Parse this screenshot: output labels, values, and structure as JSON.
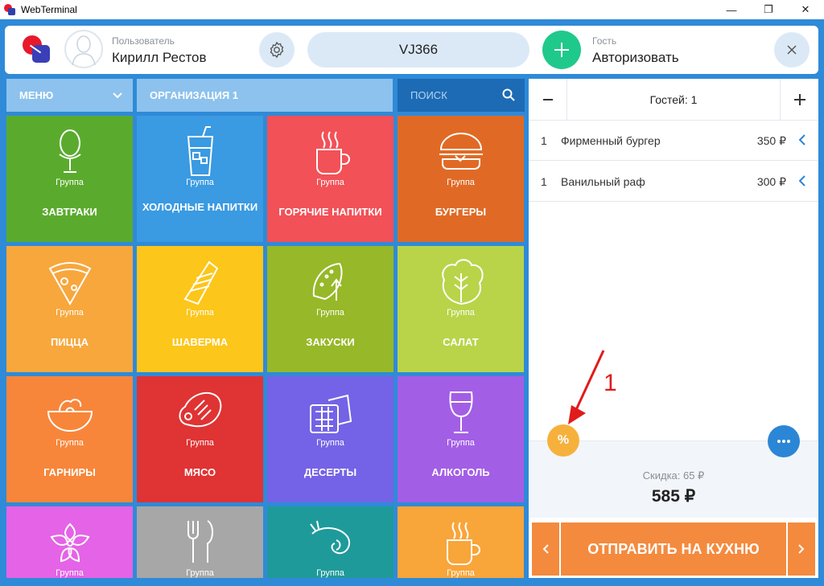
{
  "window": {
    "title": "WebTerminal",
    "minimize": "—",
    "maximize": "❐",
    "close": "✕"
  },
  "header": {
    "user_caption": "Пользователь",
    "user_name": "Кирилл Рестов",
    "order_code": "VJ366",
    "guest_caption": "Гость",
    "guest_action": "Авторизовать"
  },
  "toolbar": {
    "menu_label": "МЕНЮ",
    "org_label": "ОРГАНИЗАЦИЯ 1",
    "search_label": "ПОИСК"
  },
  "tiles": [
    {
      "group": "Группа",
      "name": "ЗАВТРАКИ",
      "color": "#5aab2d",
      "icon": "egg-icon"
    },
    {
      "group": "Группа",
      "name": "ХОЛОДНЫЕ НАПИТКИ",
      "color": "#3a9ae2",
      "icon": "cold-drink-icon"
    },
    {
      "group": "Группа",
      "name": "ГОРЯЧИЕ НАПИТКИ",
      "color": "#f25157",
      "icon": "hot-drink-icon"
    },
    {
      "group": "Группа",
      "name": "БУРГЕРЫ",
      "color": "#e06a25",
      "icon": "burger-icon"
    },
    {
      "group": "Группа",
      "name": "ПИЦЦА",
      "color": "#f7a73c",
      "icon": "pizza-icon"
    },
    {
      "group": "Группа",
      "name": "ШАВЕРМА",
      "color": "#fcc61a",
      "icon": "shawarma-icon"
    },
    {
      "group": "Группа",
      "name": "ЗАКУСКИ",
      "color": "#97b828",
      "icon": "snacks-icon"
    },
    {
      "group": "Группа",
      "name": "САЛАТ",
      "color": "#b9d449",
      "icon": "salad-icon"
    },
    {
      "group": "Группа",
      "name": "ГАРНИРЫ",
      "color": "#f7863a",
      "icon": "bowl-icon"
    },
    {
      "group": "Группа",
      "name": "МЯСО",
      "color": "#e03333",
      "icon": "meat-icon"
    },
    {
      "group": "Группа",
      "name": "ДЕСЕРТЫ",
      "color": "#7463e6",
      "icon": "dessert-icon"
    },
    {
      "group": "Группа",
      "name": "АЛКОГОЛЬ",
      "color": "#a35ee6",
      "icon": "wine-icon"
    },
    {
      "group": "Группа",
      "name": "",
      "color": "#e463e6",
      "icon": "flower-icon"
    },
    {
      "group": "Группа",
      "name": "",
      "color": "#a7a7a7",
      "icon": "cutlery-icon"
    },
    {
      "group": "Группа",
      "name": "",
      "color": "#1f9a9a",
      "icon": "shrimp-icon"
    },
    {
      "group": "Группа",
      "name": "",
      "color": "#f8a53a",
      "icon": "cup-icon"
    }
  ],
  "order": {
    "guests_label": "Гостей: 1",
    "items": [
      {
        "qty": "1",
        "name": "Фирменный бургер",
        "price": "350 ₽"
      },
      {
        "qty": "1",
        "name": "Ванильный раф",
        "price": "300 ₽"
      }
    ],
    "annotation_number": "1",
    "discount_label": "Скидка: 65 ₽",
    "total": "585 ₽",
    "send_label": "ОТПРАВИТЬ НА КУХНЮ"
  }
}
